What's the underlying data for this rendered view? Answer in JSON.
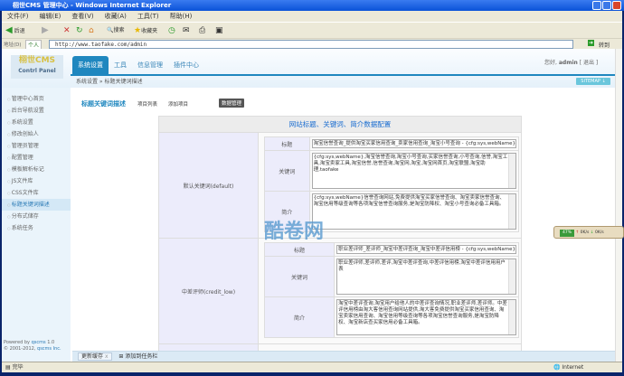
{
  "window": {
    "title": "栩世CMS 管理中心 - Windows Internet Explorer"
  },
  "menu": [
    "文件(F)",
    "编辑(E)",
    "查看(V)",
    "收藏(A)",
    "工具(T)",
    "帮助(H)"
  ],
  "toolbar": {
    "back": "后退",
    "search": "搜索",
    "favorites": "收藏夹"
  },
  "address": {
    "label": "地址(D)",
    "profile": "个人",
    "url": "http://www.taofake.com/admin",
    "go": "转到"
  },
  "logo": {
    "name": "栩世CMS",
    "sub": "Contrl Panel"
  },
  "tabs": [
    "系统设置",
    "工具",
    "信息管理",
    "插件中心"
  ],
  "greeting": {
    "hello": "您好,",
    "user": "admin",
    "logout": "[ 退出 ]"
  },
  "breadcrumb": "系统设置 » 标题关键词描述",
  "sitemap": "SITEMAP ↓",
  "sidebar": [
    "管理中心首页",
    "后台导航设置",
    "系统设置",
    "修改创始人",
    "管理员管理",
    "配置管理",
    "模板解析标记",
    "JS文件库",
    "CSS文件库",
    "标题关键词描述",
    "分布式储存",
    "系统任务"
  ],
  "sidebar_active": 9,
  "powered": {
    "line1": "Powered by",
    "link": "qscms",
    "ver": "1.0",
    "line2": "© 2001-2012,",
    "company": "qscms Inc."
  },
  "content": {
    "title": "标题关键词描述",
    "links": [
      "项目列表",
      "添加项目"
    ],
    "active": "数据管理"
  },
  "table": {
    "heading": "网站标题、关键词、简介数据配置",
    "labels": {
      "title": "标题",
      "keywords": "关键词",
      "intro": "简介"
    },
    "sections": [
      {
        "name": "默认关键词(default)",
        "title": "淘宝信誉查询_提供淘宝买家信用查询_卖家信用查询_淘宝小号查询 - {cfg:sys,webName}",
        "keywords": "{cfg:sys,webName},淘宝信誉查询,淘宝小号查询,买家信誉查询,小号查询,信誉,淘宝工具,淘宝卖家工具,淘宝信誉,信誉查询,淘宝网,淘宝,淘宝网首页,淘宝联盟,淘宝助理,taofake",
        "intro": "{cfg:sys,webName}信誉查询网站,免费提供淘宝买家信誉查询、淘宝卖家信誉查询、淘宝信用等级查询等各项淘宝信誉查询服务,是淘宝防降权、淘宝小号查询必备工具箱。"
      },
      {
        "name": "中差评师(credit_low)",
        "title": "职业差评师_差评师_淘宝中差评查询_淘宝中差评信用榜 - {cfg:sys,webName}",
        "keywords": "职业差评师,差评师,差评,淘宝中差评查询,中差评信用榜,淘宝中差评信用用户表",
        "intro": "淘宝中差评查询,淘宝用户给他人的中差评查询情况,职业差评师,差评师。中差评信用榜由淘大客信用查询网站提供,淘大客免费提供淘宝买家信用查询、淘宝卖家信用查询、淘宝信用等级查询等各项淘宝信誉查询服务,是淘宝防降权、淘宝新店查买家信用必备工具箱。"
      }
    ]
  },
  "bottombar": {
    "cache": "更新缓存",
    "close": "x",
    "add": "添加到任务栏"
  },
  "status": {
    "text": "完毕",
    "zone": "Internet"
  },
  "netmon": {
    "cpu": "47%",
    "up": "0K/s",
    "down": "0K/s"
  },
  "watermark": "酷卷网",
  "colors": {
    "accent": "#1f87bf",
    "titlebar": "#0a52d8"
  }
}
